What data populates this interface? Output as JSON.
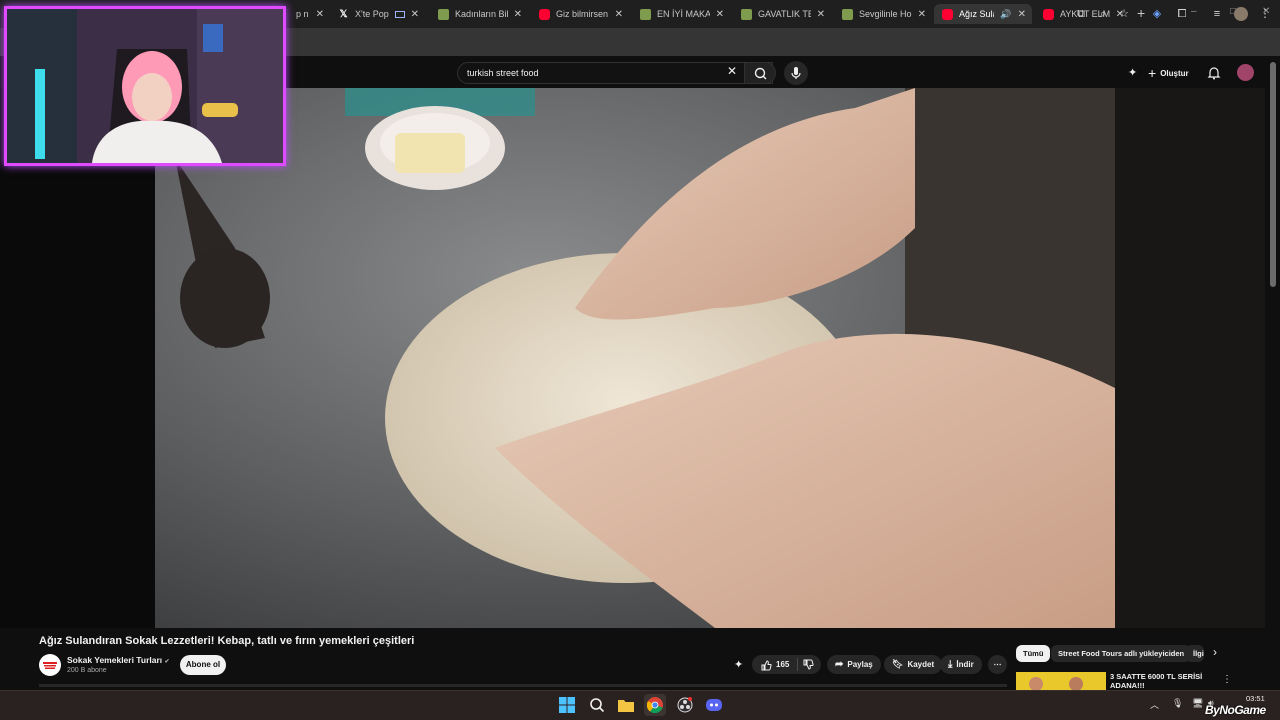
{
  "browser": {
    "tabs": [
      {
        "title": "p n",
        "favicon": "#2f3a55",
        "active": false
      },
      {
        "title": "X'te Popüler",
        "favicon": "#000000",
        "active": false
      },
      {
        "title": "Kadınların Bile",
        "favicon": "#7f9b4e",
        "active": false
      },
      {
        "title": "Giz bilmirsen e",
        "favicon": "#ff0033",
        "active": false
      },
      {
        "title": "EN İYİ MAKARI",
        "favicon": "#7f9b4e",
        "active": false
      },
      {
        "title": "GAVATLIK TEST",
        "favicon": "#7f9b4e",
        "active": false
      },
      {
        "title": "Sevgilinle Holk",
        "favicon": "#7f9b4e",
        "active": false
      },
      {
        "title": "Ağız Sulanc",
        "favicon": "#ff0033",
        "active": true
      },
      {
        "title": "AYKUT ELMAS",
        "favicon": "#ff0033",
        "active": false
      }
    ],
    "new_tab": "+",
    "window_controls": [
      "–",
      "□",
      "✕"
    ]
  },
  "youtube": {
    "search": {
      "query": "turkish street food"
    },
    "create_label": "Oluştur"
  },
  "video": {
    "title": "Ağız Sulandıran Sokak Lezzetleri! Kebap, tatlı ve fırın yemekleri çeşitleri",
    "channel": {
      "name": "Sokak Yemekleri Turları",
      "verified": "✔",
      "subscribers": "200 B abone",
      "subscribe_label": "Abone ol"
    },
    "actions": {
      "likes": "165",
      "share": "Paylaş",
      "save": "Kaydet",
      "download": "İndir",
      "more": "⋯"
    }
  },
  "recommendations": {
    "chips": [
      "Tümü",
      "Street Food Tours adlı yükleyiciden",
      "İlgili"
    ],
    "first_item_title": "3 SAATTE 6000 TL SERİSİ ADANA!!!"
  },
  "taskbar": {
    "time": "03:51"
  },
  "overlay": {
    "watermark": "ByNoGame"
  },
  "colors": {
    "youtube_red": "#ff0033",
    "webcam_border": "#e04bff",
    "webcam_glow": "#4fd6ff"
  }
}
